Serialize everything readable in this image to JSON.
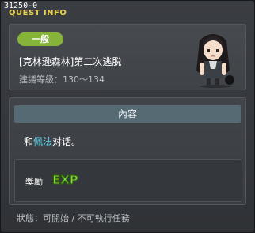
{
  "window": {
    "code": "31250-0",
    "title": "QUEST INFO"
  },
  "quest": {
    "category_badge": "一般",
    "name": "[克林逊森林]第二次逃脱",
    "level_req": "建議等級：130～134"
  },
  "content": {
    "header": "內容",
    "text_prefix": "和",
    "npc_name": "佩法",
    "text_suffix": "对话。"
  },
  "reward": {
    "label": "獎勵",
    "icon": "exp-icon",
    "icon_text": "EXP"
  },
  "status": {
    "text": "狀態：可開始 / 不可執行任務"
  },
  "colors": {
    "title": "#e9d24a",
    "badge": "#86b33a",
    "npc_highlight": "#5fd1e6",
    "exp_green": "#7fe03a",
    "exp_yellow": "#f3e33c"
  }
}
